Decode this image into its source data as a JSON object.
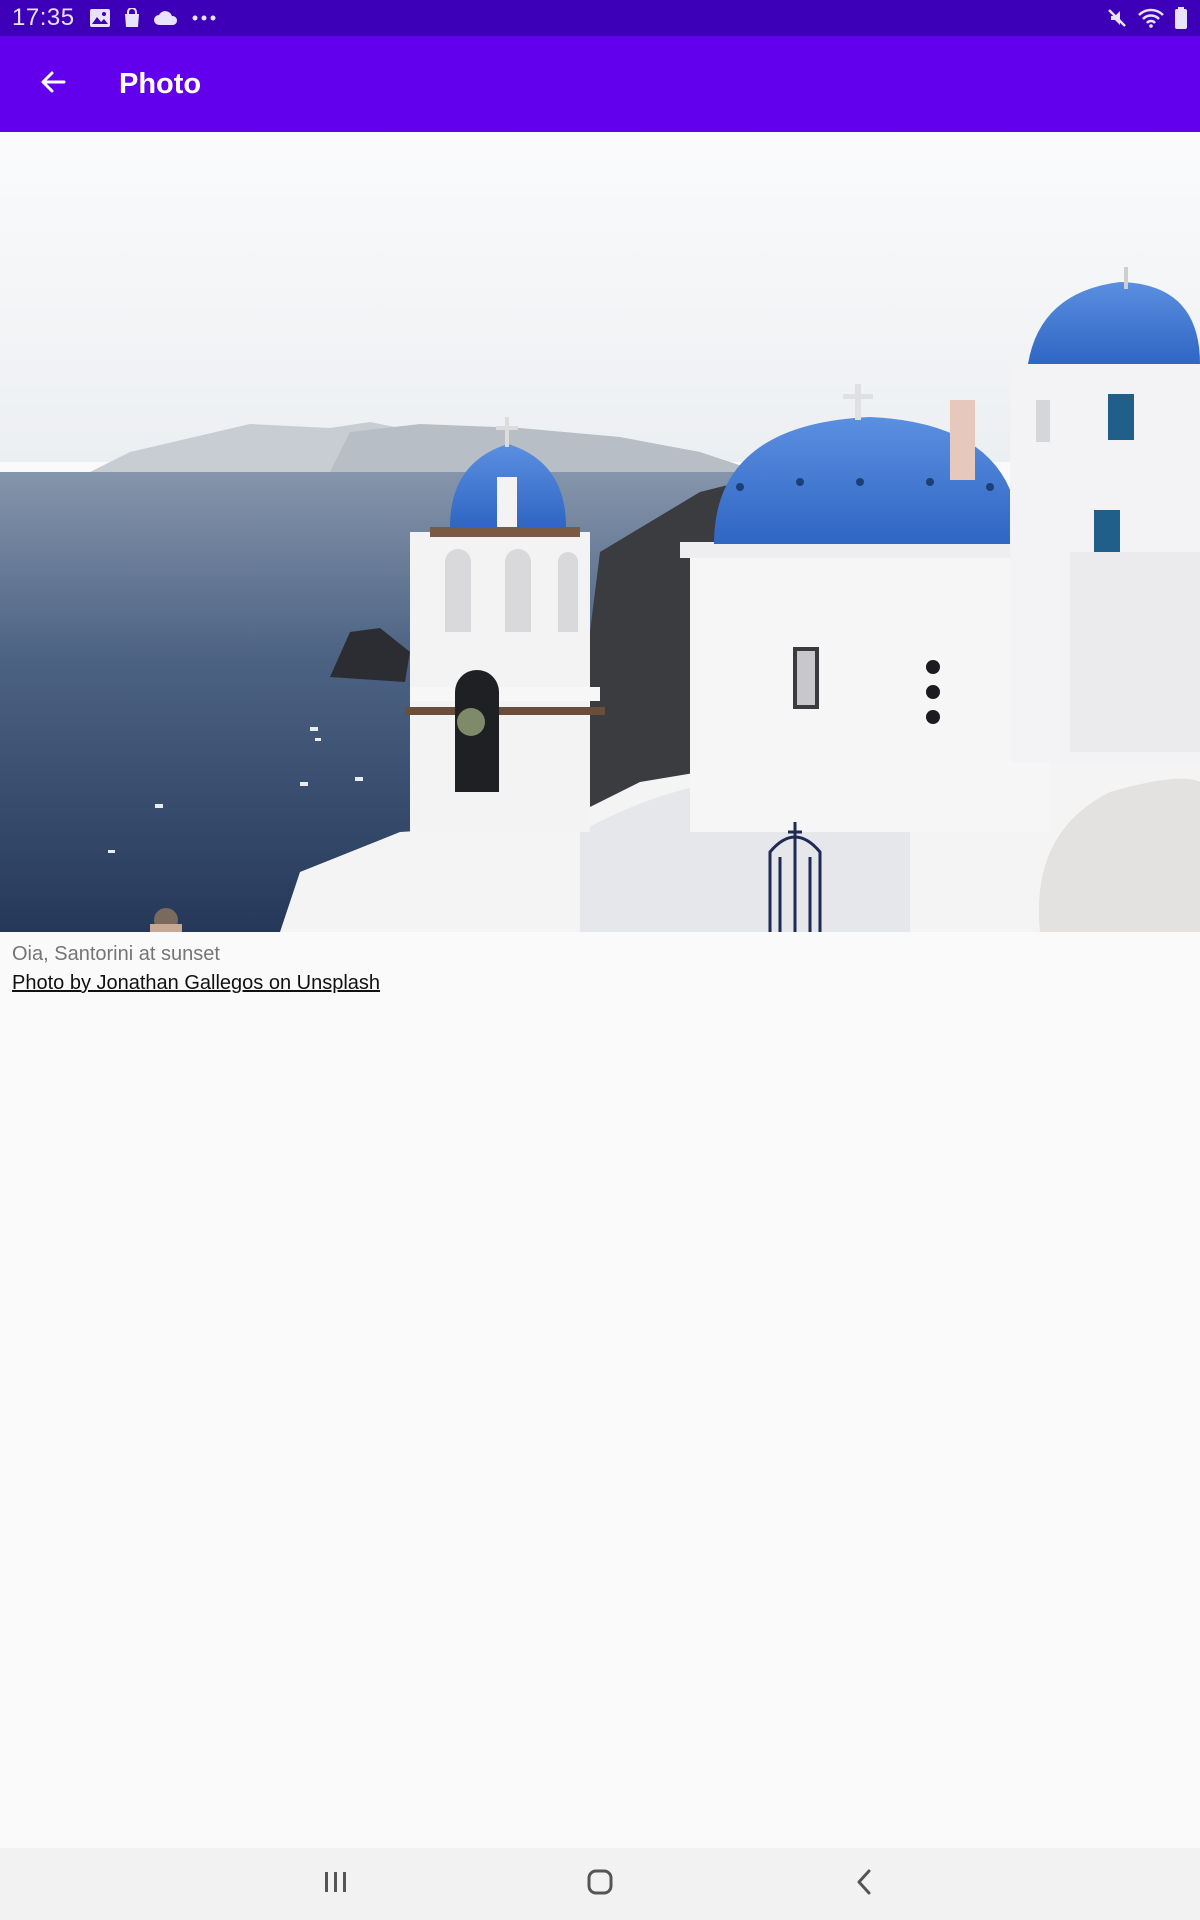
{
  "status_bar": {
    "time": "17:35",
    "left_icons": [
      "gallery-icon",
      "shopping-bag-icon",
      "cloud-icon",
      "more-dots-icon"
    ],
    "right_icons": [
      "mute-icon",
      "wifi-icon",
      "battery-icon"
    ]
  },
  "app_bar": {
    "back_icon": "arrow-back-icon",
    "title": "Photo",
    "color": "#6200ee"
  },
  "photo": {
    "caption": "Oia, Santorini at sunset",
    "credit": "Photo by Jonathan Gallegos on Unsplash"
  },
  "nav_bar": {
    "buttons": [
      "recents-icon",
      "home-icon",
      "back-icon"
    ]
  }
}
